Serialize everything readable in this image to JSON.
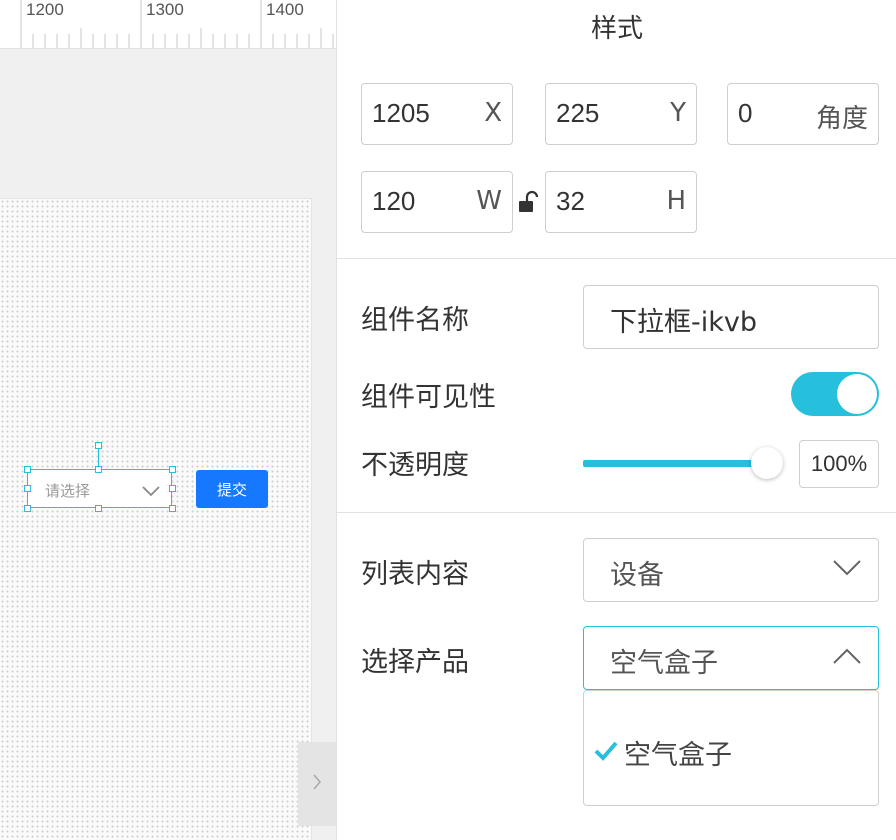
{
  "ruler": {
    "labels": [
      "1200",
      "1300",
      "1400"
    ]
  },
  "canvas": {
    "dropdown_placeholder": "请选择",
    "submit_label": "提交"
  },
  "panel": {
    "title": "样式",
    "position": {
      "x": {
        "value": "1205",
        "unit": "X"
      },
      "y": {
        "value": "225",
        "unit": "Y"
      },
      "angle": {
        "value": "0",
        "unit": "角度"
      },
      "w": {
        "value": "120",
        "unit": "W"
      },
      "h": {
        "value": "32",
        "unit": "H"
      }
    },
    "component_name_label": "组件名称",
    "component_name_value": "下拉框-ikvb",
    "visibility_label": "组件可见性",
    "visibility_on": true,
    "opacity_label": "不透明度",
    "opacity_value": "100%",
    "opacity_level": 1.0,
    "list_content_label": "列表内容",
    "list_content_value": "设备",
    "select_product_label": "选择产品",
    "select_product_value": "空气盒子",
    "product_options": [
      {
        "label": "空气盒子",
        "selected": true
      }
    ]
  },
  "colors": {
    "accent": "#26c0dc",
    "primary_button": "#1677ff"
  }
}
